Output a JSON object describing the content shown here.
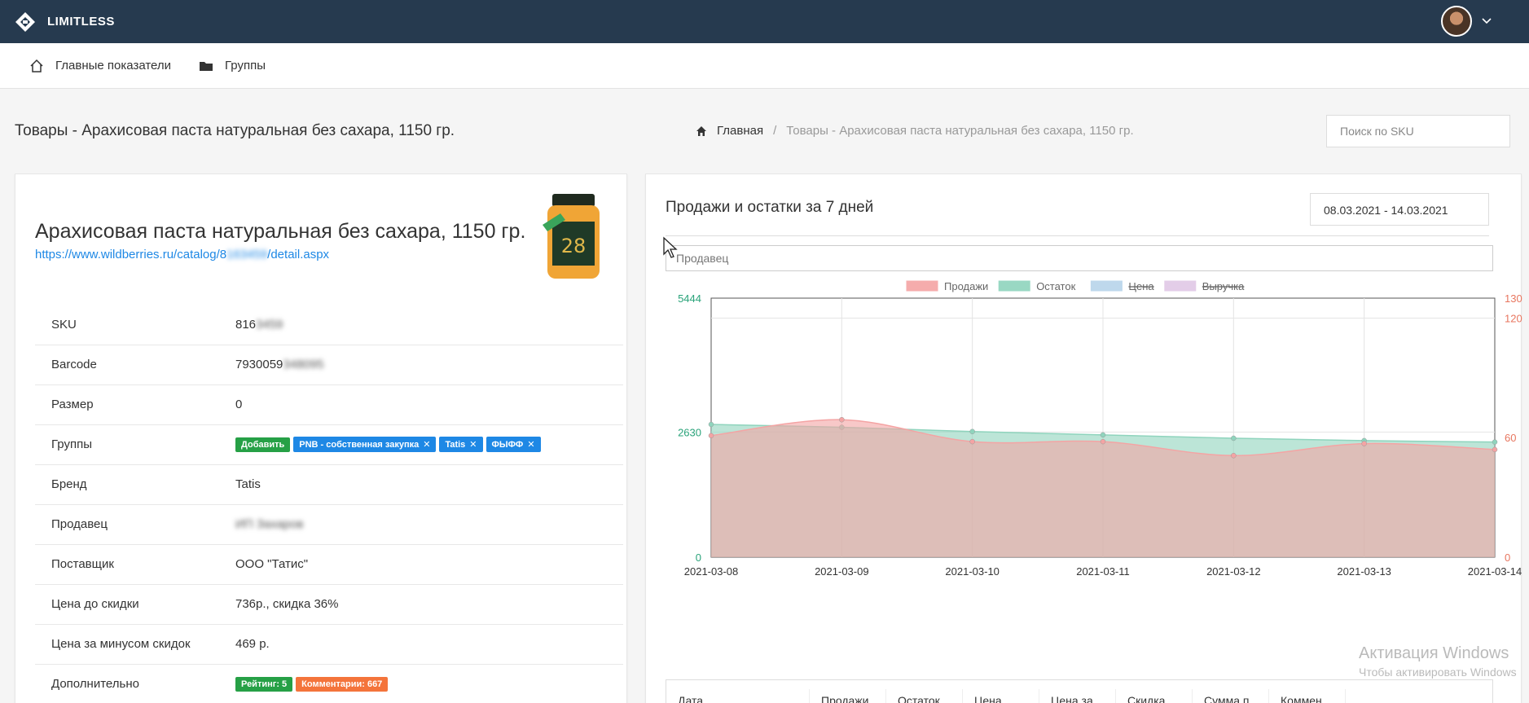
{
  "app": {
    "name": "LIMITLESS"
  },
  "subnav": {
    "dashboard": "Главные показатели",
    "groups": "Группы"
  },
  "page": {
    "title": "Товары - Арахисовая паста натуральная без сахара, 1150 гр.",
    "breadcrumb": {
      "home": "Главная",
      "current": "Товары - Арахисовая паста натуральная без сахара, 1150 гр."
    },
    "search_placeholder": "Поиск по SKU"
  },
  "product": {
    "name": "Арахисовая паста натуральная без сахара, 1150 гр.",
    "link_prefix": "https://www.wildberries.ru/catalog/8",
    "link_hidden": "163459",
    "link_suffix": "/detail.aspx",
    "jar_label": "28",
    "props": {
      "sku_label": "SKU",
      "sku_visible": "816",
      "sku_hidden": "3459",
      "barcode_label": "Barcode",
      "barcode_visible": "7930059",
      "barcode_hidden": "348095",
      "size_label": "Размер",
      "size_value": "0",
      "groups_label": "Группы",
      "groups_add": "Добавить",
      "groups": [
        "PNB - собственная закупка",
        "Tatis",
        "ФЫФФ"
      ],
      "brand_label": "Бренд",
      "brand_value": "Tatis",
      "seller_label": "Продавец",
      "seller_value": "ИП Захаров",
      "supplier_label": "Поставщик",
      "supplier_value": "ООО \"Татис\"",
      "price_before_label": "Цена до скидки",
      "price_before_value": "736р., скидка 36%",
      "price_after_label": "Цена за минусом скидок",
      "price_after_value": "469 р.",
      "extra_label": "Дополнительно",
      "rating_badge": "Рейтинг: 5",
      "comments_badge": "Комментарии: 667"
    }
  },
  "chart_panel": {
    "title": "Продажи и остатки за 7 дней",
    "date_range": "08.03.2021 - 14.03.2021",
    "seller_placeholder": "Продавец"
  },
  "chart_data": {
    "type": "area",
    "x": [
      "2021-03-08",
      "2021-03-09",
      "2021-03-10",
      "2021-03-11",
      "2021-03-12",
      "2021-03-13",
      "2021-03-14"
    ],
    "series": [
      {
        "name": "Продажи",
        "axis": "right",
        "values": [
          61,
          69,
          58,
          58,
          51,
          57,
          54
        ],
        "color": "#f4a4a4"
      },
      {
        "name": "Остаток",
        "axis": "left",
        "values": [
          2790,
          2730,
          2640,
          2570,
          2500,
          2450,
          2420
        ],
        "color": "#8fd4bd"
      },
      {
        "name": "Цена",
        "axis": "right",
        "values": [],
        "color": "#b7d4ea",
        "hidden": true
      },
      {
        "name": "Выручка",
        "axis": "right",
        "values": [],
        "color": "#e1c8e6",
        "hidden": true
      }
    ],
    "y_left": {
      "ticks": [
        0,
        2630,
        5444
      ],
      "range": [
        0,
        5444
      ]
    },
    "y_right": {
      "ticks": [
        0,
        60,
        120,
        130
      ],
      "range": [
        0,
        130
      ]
    },
    "legend_position": "top"
  },
  "table_header": [
    "Дата",
    "Продажи",
    "Остаток",
    "Цена",
    "Цена за ...",
    "Скидка",
    "Сумма п...",
    "Коммен..."
  ],
  "watermark": {
    "line1": "Активация Windows",
    "line2": "Чтобы активировать Windows"
  },
  "colors": {
    "navbar": "#263a4f",
    "link": "#1e88e5",
    "tag_green": "#26a046",
    "tag_blue": "#1e88e5",
    "tag_orange": "#f4743b"
  }
}
